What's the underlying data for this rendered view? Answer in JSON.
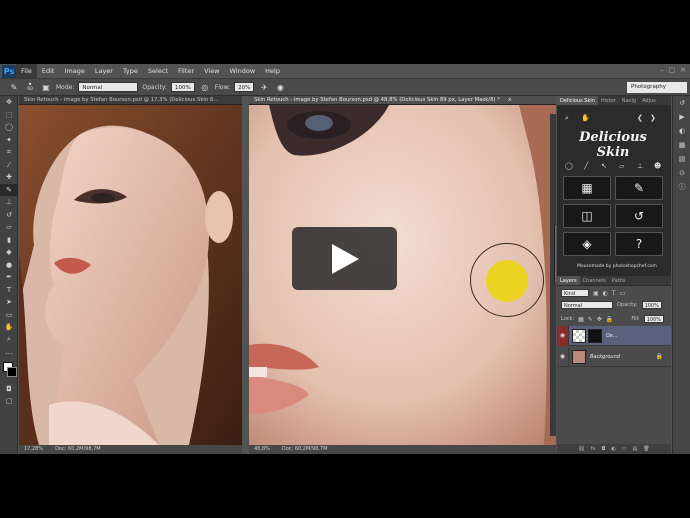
{
  "app": {
    "logo": "Ps",
    "workspace": "Photography"
  },
  "menu": [
    "File",
    "Edit",
    "Image",
    "Layer",
    "Type",
    "Select",
    "Filter",
    "View",
    "Window",
    "Help"
  ],
  "window_controls": [
    "–",
    "□",
    "✕"
  ],
  "options": {
    "brush_size": "60",
    "mode_label": "Mode:",
    "mode_value": "Normal",
    "opacity_label": "Opacity:",
    "opacity_value": "100%",
    "flow_label": "Flow:",
    "flow_value": "20%"
  },
  "documents": [
    {
      "tab": "Skin Retouch - image by Stefan Bourson.psd @ 17,3% (Delicious Skin 8...",
      "zoom": "17,28%",
      "doc": "Doc: 60,2M/98,7M"
    },
    {
      "tab": "Skin Retouch - image by Stefan Bourson.psd @ 48,8% (Delicious Skin 89 px, Layer Mask/8) *",
      "zoom": "48,8%",
      "doc": "Doc: 60,2M/98,7M",
      "close": "×"
    }
  ],
  "panel_tabs": [
    "Delicious Skin",
    "Histor",
    "Navig",
    "Adjus"
  ],
  "delicious_skin": {
    "title": "Delicious Skin",
    "buttons": [
      {
        "icon": "calculator-icon",
        "glyph": "▦"
      },
      {
        "icon": "brush-icon",
        "glyph": "✎"
      },
      {
        "icon": "compare-icon",
        "glyph": "◫"
      },
      {
        "icon": "history-icon",
        "glyph": "↺"
      },
      {
        "icon": "layers-icon",
        "glyph": "◈"
      },
      {
        "icon": "help-icon",
        "glyph": "?"
      }
    ],
    "credit": "Mousemade by photoshopchef.com"
  },
  "layers_panel": {
    "tabs": [
      "Layers",
      "Channels",
      "Paths"
    ],
    "kind": "Kind",
    "blend": "Normal",
    "opacity_label": "Opacity:",
    "opacity_value": "100%",
    "lock_label": "Lock:",
    "fill_label": "Fill:",
    "fill_value": "100%",
    "layers": [
      {
        "name": "De...",
        "selected": true
      },
      {
        "name": "Background",
        "selected": false
      }
    ],
    "bottom_icons": [
      "fx",
      "◘",
      "◐",
      "▭",
      "▤",
      "🗑"
    ]
  },
  "colors": {
    "accent": "#59617d",
    "yellow_dot": "#ecd321",
    "bg": "#535353"
  }
}
